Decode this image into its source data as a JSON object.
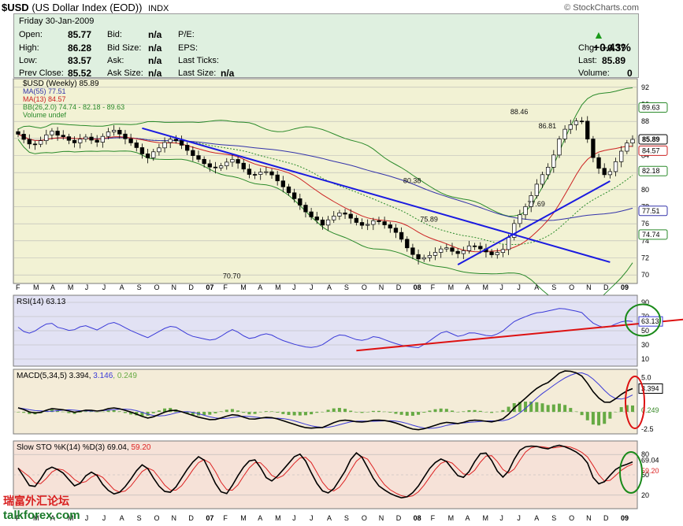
{
  "header": {
    "symbol": "$USD",
    "name": "(US Dollar Index (EOD))",
    "exchange": "INDX",
    "site": "© StockCharts.com"
  },
  "quote": {
    "date": "Friday  30-Jan-2009",
    "open_label": "Open:",
    "open": "85.77",
    "high_label": "High:",
    "high": "86.28",
    "low_label": "Low:",
    "low": "83.57",
    "prev_label": "Prev Close:",
    "prev": "85.52",
    "bid_label": "Bid:",
    "bid": "n/a",
    "bidsize_label": "Bid Size:",
    "bidsize": "n/a",
    "ask_label": "Ask:",
    "ask": "n/a",
    "asksize_label": "Ask Size:",
    "asksize": "n/a",
    "pe_label": "P/E:",
    "eps_label": "EPS:",
    "lastticks_label": "Last Ticks:",
    "lastsize_label": "Last Size:",
    "lastsize": "n/a",
    "pct_change": "+0.43%",
    "chg_label": "Chg:",
    "chg": "+0.37",
    "last_label": "Last:",
    "last": "85.89",
    "vol_label": "Volume:",
    "volume": "0"
  },
  "colors": {
    "price_bg": "#f2f2d4",
    "rsi_bg": "#e2e2f4",
    "macd_bg": "#f4ecd8",
    "sto_bg": "#f6e2d8",
    "ma55": "#3333aa",
    "ma13": "#cc2222",
    "bb": "#2a8a2a",
    "trend": "#1a1ae0",
    "rsi_trend": "#dd1111"
  },
  "watermark": "talkforex.com",
  "chart_data": [
    {
      "type": "candlestick",
      "title": "$USD (Weekly) 85.89",
      "legend": [
        "MA(55) 77.51",
        "MA(13) 84.57",
        "BB(26,2.0) 74.74 - 82.18 - 89.63",
        "Volume undef"
      ],
      "ylim": [
        69,
        93
      ],
      "yticks": [
        70,
        72,
        74,
        76,
        78,
        80,
        82,
        84,
        86,
        88,
        90,
        92
      ],
      "x_labels": [
        "F",
        "M",
        "A",
        "M",
        "J",
        "J",
        "A",
        "S",
        "O",
        "N",
        "D",
        "07",
        "F",
        "M",
        "A",
        "M",
        "J",
        "J",
        "A",
        "S",
        "O",
        "N",
        "D",
        "08",
        "F",
        "M",
        "A",
        "M",
        "J",
        "J",
        "A",
        "S",
        "O",
        "N",
        "D",
        "09"
      ],
      "close_path": [
        86.5,
        85.8,
        85.2,
        85.4,
        86.1,
        87.0,
        86.4,
        86.2,
        85.7,
        85.4,
        86.3,
        86.0,
        85.4,
        86.2,
        86.8,
        87.0,
        86.3,
        85.7,
        85.2,
        84.3,
        83.7,
        84.5,
        85.0,
        85.8,
        86.0,
        85.4,
        84.7,
        84.0,
        83.5,
        82.9,
        82.5,
        82.6,
        83.1,
        83.6,
        83.1,
        82.3,
        81.6,
        81.9,
        82.2,
        81.9,
        81.1,
        80.3,
        79.5,
        78.7,
        77.8,
        76.9,
        76.6,
        75.8,
        76.5,
        77.0,
        77.4,
        76.9,
        76.3,
        75.8,
        75.9,
        76.4,
        76.2,
        75.7,
        75.3,
        74.5,
        73.3,
        72.4,
        71.8,
        72.1,
        72.4,
        72.9,
        73.3,
        72.8,
        72.5,
        72.9,
        73.6,
        73.2,
        72.9,
        72.3,
        72.6,
        73.0,
        74.7,
        76.6,
        77.4,
        78.8,
        80.4,
        81.7,
        82.7,
        84.4,
        86.7,
        87.4,
        87.9,
        88.4,
        86.0,
        83.5,
        82.2,
        81.5,
        82.7,
        84.2,
        85.4,
        85.89
      ],
      "annotations": [
        {
          "x": 38,
          "y": 70.7,
          "label": "70.70"
        },
        {
          "x": 73,
          "y": 75.89,
          "label": "75.89"
        },
        {
          "x": 70,
          "y": 80.38,
          "label": "80.38"
        },
        {
          "x": 89,
          "y": 88.46,
          "label": "88.46"
        },
        {
          "x": 92,
          "y": 77.69,
          "label": "77.69"
        },
        {
          "x": 94,
          "y": 86.81,
          "label": "86.81"
        }
      ],
      "side_labels": [
        {
          "y": 89.63,
          "label": "89.63"
        },
        {
          "y": 85.89,
          "label": "85.89"
        },
        {
          "y": 84.57,
          "label": "84.57"
        },
        {
          "y": 82.18,
          "label": "82.18"
        },
        {
          "y": 77.51,
          "label": "77.51"
        },
        {
          "y": 74.74,
          "label": "74.74"
        }
      ],
      "trendlines": [
        {
          "from": [
            22,
            87.2
          ],
          "to": [
            105,
            71.5
          ]
        },
        {
          "from": [
            78,
            71.2
          ],
          "to": [
            105,
            81.0
          ]
        }
      ]
    },
    {
      "type": "line",
      "title": "RSI(14) 63.13",
      "ylim": [
        0,
        100
      ],
      "yticks": [
        10,
        30,
        50,
        70,
        90
      ],
      "current": "63.13",
      "series_path": [
        55,
        48,
        46,
        52,
        58,
        62,
        55,
        53,
        50,
        52,
        58,
        56,
        50,
        55,
        60,
        62,
        57,
        52,
        48,
        44,
        40,
        45,
        50,
        55,
        57,
        52,
        46,
        42,
        40,
        38,
        36,
        40,
        46,
        52,
        48,
        42,
        38,
        42,
        46,
        45,
        40,
        36,
        33,
        30,
        28,
        26,
        27,
        30,
        36,
        42,
        45,
        42,
        38,
        36,
        38,
        42,
        40,
        36,
        33,
        30,
        28,
        27,
        26,
        32,
        38,
        45,
        50,
        46,
        42,
        44,
        48,
        46,
        44,
        42,
        45,
        50,
        58,
        65,
        68,
        72,
        75,
        76,
        78,
        80,
        82,
        80,
        78,
        77,
        68,
        60,
        56,
        54,
        58,
        62,
        64,
        63.13
      ]
    },
    {
      "type": "line",
      "title": "MACD(5,34,5) 3.394, 3.146, 0.249",
      "series": [
        {
          "name": "MACD",
          "value": "3.394"
        },
        {
          "name": "signal",
          "value": "3.146"
        },
        {
          "name": "histogram",
          "value": "0.249"
        }
      ],
      "ylim": [
        -3.2,
        6.2
      ],
      "yticks": [
        -2.5,
        5.0
      ],
      "macd_path": [
        0.6,
        0.3,
        -0.1,
        -0.2,
        0.1,
        0.5,
        0.4,
        0.3,
        0.1,
        -0.1,
        0.2,
        0.3,
        0.1,
        0.2,
        0.5,
        0.6,
        0.4,
        0.1,
        -0.2,
        -0.6,
        -0.9,
        -0.7,
        -0.3,
        0.1,
        0.3,
        0.1,
        -0.2,
        -0.5,
        -0.8,
        -1.0,
        -1.2,
        -1.0,
        -0.7,
        -0.4,
        -0.5,
        -0.8,
        -1.1,
        -1.0,
        -0.8,
        -0.8,
        -1.0,
        -1.3,
        -1.6,
        -1.9,
        -2.2,
        -2.4,
        -2.3,
        -2.3,
        -1.9,
        -1.5,
        -1.2,
        -1.2,
        -1.4,
        -1.5,
        -1.4,
        -1.2,
        -1.2,
        -1.3,
        -1.5,
        -1.8,
        -2.2,
        -2.5,
        -2.6,
        -2.4,
        -2.1,
        -1.8,
        -1.5,
        -1.6,
        -1.7,
        -1.5,
        -1.2,
        -1.2,
        -1.3,
        -1.5,
        -1.3,
        -1.0,
        -0.2,
        0.9,
        1.6,
        2.5,
        3.3,
        3.9,
        4.3,
        5.1,
        5.9,
        6.0,
        5.8,
        5.4,
        4.2,
        2.8,
        1.8,
        1.2,
        1.6,
        2.4,
        3.0,
        3.394
      ]
    },
    {
      "type": "line",
      "title": "Slow STO %K(14) %D(3) 69.04, 59.20",
      "series": [
        {
          "name": "%K",
          "value": "69.04"
        },
        {
          "name": "%D",
          "value": "59.20"
        }
      ],
      "ylim": [
        0,
        100
      ],
      "yticks": [
        20,
        50,
        80
      ],
      "k_path": [
        60,
        45,
        30,
        35,
        55,
        62,
        58,
        52,
        40,
        30,
        45,
        55,
        50,
        35,
        25,
        20,
        28,
        40,
        55,
        65,
        58,
        40,
        28,
        22,
        30,
        45,
        60,
        72,
        80,
        62,
        40,
        25,
        22,
        38,
        55,
        68,
        75,
        62,
        45,
        40,
        52,
        62,
        75,
        82,
        70,
        50,
        32,
        22,
        25,
        40,
        55,
        75,
        85,
        70,
        50,
        35,
        28,
        22,
        18,
        15,
        20,
        30,
        45,
        60,
        70,
        75,
        65,
        50,
        45,
        55,
        72,
        85,
        80,
        60,
        45,
        55,
        75,
        90,
        92,
        93,
        90,
        88,
        92,
        94,
        90,
        86,
        80,
        70,
        45,
        35,
        42,
        55,
        62,
        65,
        69.04
      ]
    }
  ]
}
